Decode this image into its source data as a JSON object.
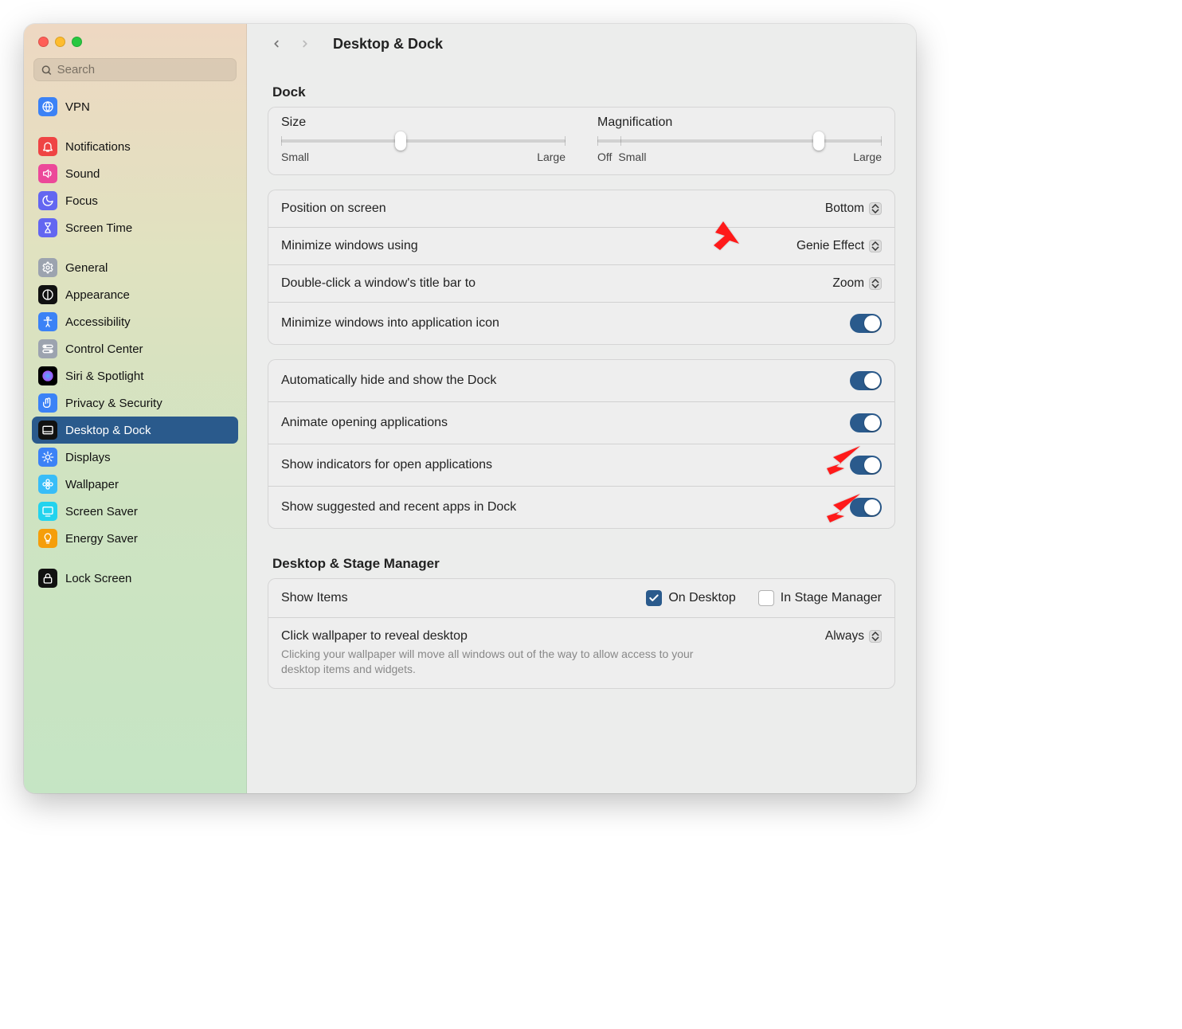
{
  "search": {
    "placeholder": "Search"
  },
  "sidebar": {
    "groups": [
      {
        "items": [
          {
            "label": "VPN",
            "icon_bg": "#3b82f6",
            "glyph": "globe"
          }
        ]
      },
      {
        "items": [
          {
            "label": "Notifications",
            "icon_bg": "#ef4444",
            "glyph": "bell"
          },
          {
            "label": "Sound",
            "icon_bg": "#ec4899",
            "glyph": "speaker"
          },
          {
            "label": "Focus",
            "icon_bg": "#6366f1",
            "glyph": "moon"
          },
          {
            "label": "Screen Time",
            "icon_bg": "#6366f1",
            "glyph": "hourglass"
          }
        ]
      },
      {
        "items": [
          {
            "label": "General",
            "icon_bg": "#9ca3af",
            "glyph": "gear"
          },
          {
            "label": "Appearance",
            "icon_bg": "#111111",
            "glyph": "appearance"
          },
          {
            "label": "Accessibility",
            "icon_bg": "#3b82f6",
            "glyph": "accessibility"
          },
          {
            "label": "Control Center",
            "icon_bg": "#9ca3af",
            "glyph": "switches"
          },
          {
            "label": "Siri & Spotlight",
            "icon_bg": "#000000",
            "glyph": "siri"
          },
          {
            "label": "Privacy & Security",
            "icon_bg": "#3b82f6",
            "glyph": "hand"
          },
          {
            "label": "Desktop & Dock",
            "icon_bg": "#111111",
            "glyph": "dock",
            "selected": true
          },
          {
            "label": "Displays",
            "icon_bg": "#3b82f6",
            "glyph": "sun"
          },
          {
            "label": "Wallpaper",
            "icon_bg": "#38bdf8",
            "glyph": "flower"
          },
          {
            "label": "Screen Saver",
            "icon_bg": "#22d3ee",
            "glyph": "screensaver"
          },
          {
            "label": "Energy Saver",
            "icon_bg": "#f59e0b",
            "glyph": "bulb"
          }
        ]
      },
      {
        "items": [
          {
            "label": "Lock Screen",
            "icon_bg": "#111111",
            "glyph": "lock"
          }
        ]
      }
    ]
  },
  "header": {
    "title": "Desktop & Dock"
  },
  "dock": {
    "title": "Dock",
    "size": {
      "label": "Size",
      "min": "Small",
      "max": "Large",
      "value_pct": 42
    },
    "magnification": {
      "label": "Magnification",
      "off": "Off",
      "min": "Small",
      "max": "Large",
      "value_pct": 78
    },
    "rows": [
      {
        "label": "Position on screen",
        "value": "Bottom",
        "type": "select"
      },
      {
        "label": "Minimize windows using",
        "value": "Genie Effect",
        "type": "select"
      },
      {
        "label": "Double-click a window's title bar to",
        "value": "Zoom",
        "type": "select"
      },
      {
        "label": "Minimize windows into application icon",
        "value": true,
        "type": "toggle"
      }
    ],
    "rows2": [
      {
        "label": "Automatically hide and show the Dock",
        "value": true,
        "type": "toggle"
      },
      {
        "label": "Animate opening applications",
        "value": true,
        "type": "toggle"
      },
      {
        "label": "Show indicators for open applications",
        "value": true,
        "type": "toggle"
      },
      {
        "label": "Show suggested and recent apps in Dock",
        "value": true,
        "type": "toggle"
      }
    ]
  },
  "stage": {
    "title": "Desktop & Stage Manager",
    "show_items": {
      "label": "Show Items",
      "on_desktop": {
        "label": "On Desktop",
        "checked": true
      },
      "in_stage": {
        "label": "In Stage Manager",
        "checked": false
      }
    },
    "reveal": {
      "label": "Click wallpaper to reveal desktop",
      "value": "Always",
      "desc": "Clicking your wallpaper will move all windows out of the way to allow access to your desktop items and widgets."
    }
  }
}
